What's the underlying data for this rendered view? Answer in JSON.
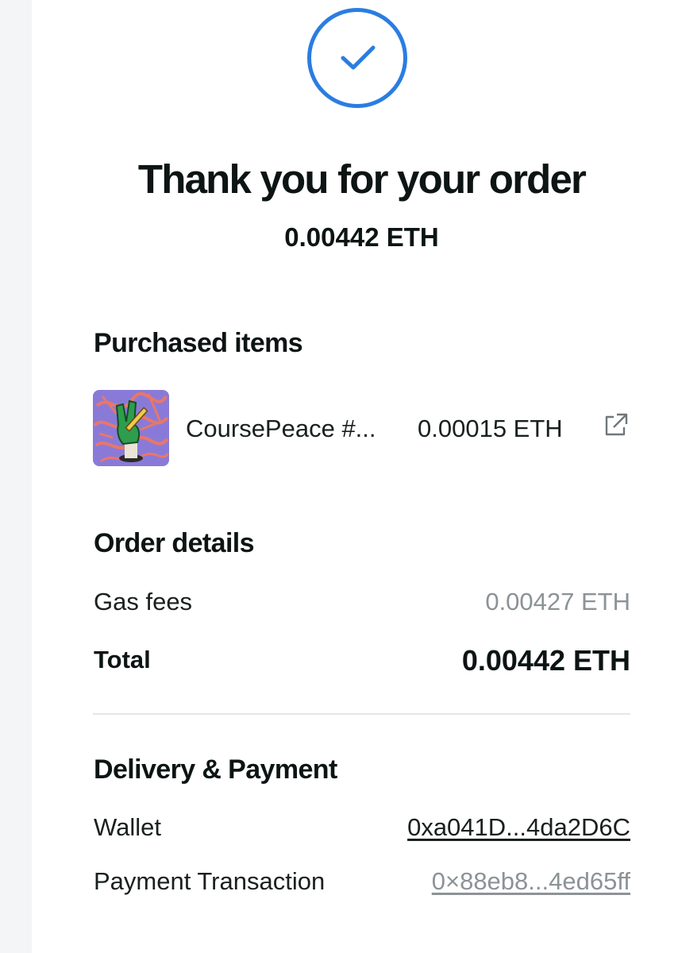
{
  "confirmation": {
    "title": "Thank you for your order",
    "amount": "0.00442 ETH",
    "accent_color": "#2a7de1",
    "icon": "check-circle-icon"
  },
  "purchased_items": {
    "heading": "Purchased items",
    "items": [
      {
        "name": "CoursePeace #...",
        "price": "0.00015 ETH",
        "link_icon": "external-link-icon"
      }
    ]
  },
  "order_details": {
    "heading": "Order details",
    "gas_fees_label": "Gas fees",
    "gas_fees_value": "0.00427 ETH",
    "total_label": "Total",
    "total_value": "0.00442 ETH"
  },
  "delivery_payment": {
    "heading": "Delivery & Payment",
    "wallet_label": "Wallet",
    "wallet_value": "0xa041D...4da2D6C",
    "transaction_label": "Payment Transaction",
    "transaction_value": "0×88eb8...4ed65ff"
  }
}
